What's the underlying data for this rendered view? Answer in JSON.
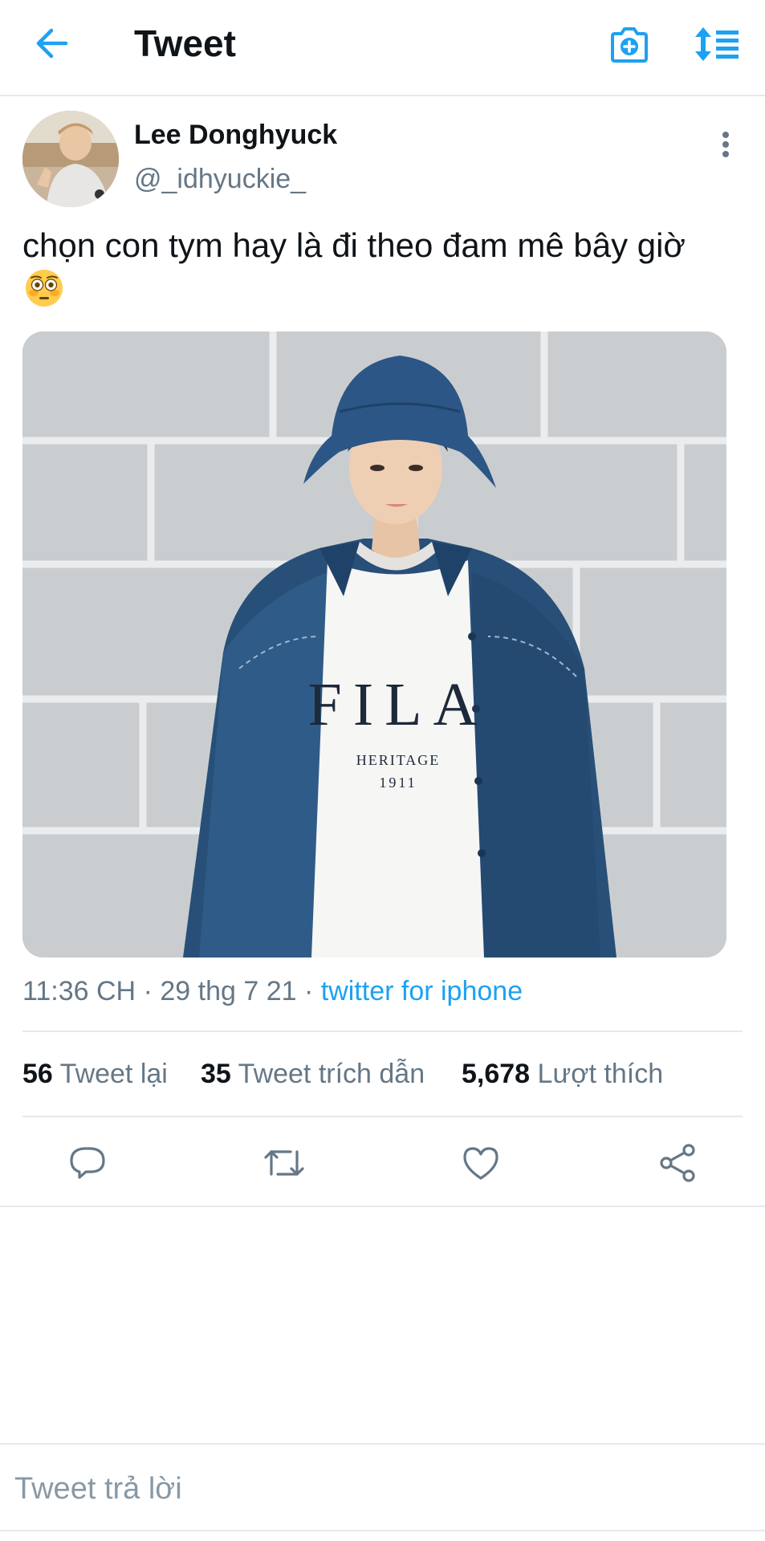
{
  "header": {
    "title": "Tweet",
    "back_icon": "arrow-left-icon",
    "camera_icon": "camera-plus-icon",
    "sort_icon": "sparkle-sort-icon"
  },
  "author": {
    "name": "Lee Donghyuck",
    "handle": "@_idhyuckie_"
  },
  "tweet": {
    "text": "chọn con tym hay là đi theo đam mê bây giờ",
    "emoji": "flushed-face",
    "media_shirt": {
      "brand": "FILA",
      "line": "HERITAGE",
      "year": "1911"
    }
  },
  "meta": {
    "time": "11:36 CH",
    "separator": "·",
    "date": "29 thg 7 21",
    "source": "twitter for iphone"
  },
  "stats": {
    "retweets_count": "56",
    "retweets_label": "Tweet lại",
    "quotes_count": "35",
    "quotes_label": "Tweet trích dẫn",
    "likes_count": "5,678",
    "likes_label": "Lượt thích"
  },
  "reply": {
    "placeholder": "Tweet trả lời"
  },
  "colors": {
    "accent": "#1da1f2",
    "text": "#0f1419",
    "secondary": "#657786",
    "divider": "#e6e9ec"
  }
}
